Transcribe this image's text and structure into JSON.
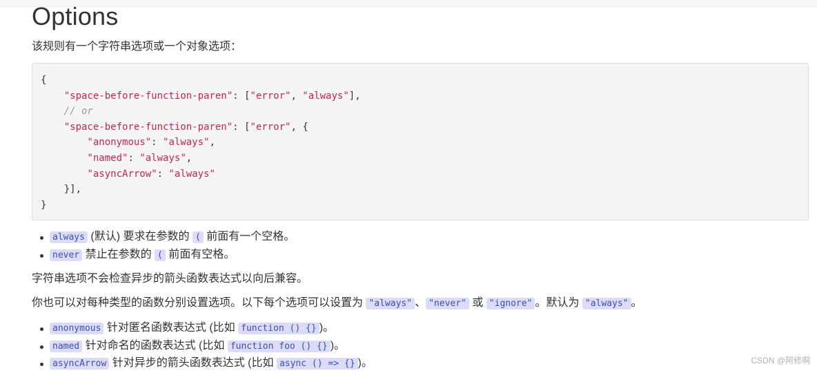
{
  "heading": "Options",
  "intro": "该规则有一个字符串选项或一个对象选项：",
  "code": {
    "open_brace": "{",
    "line1_key": "\"space-before-function-paren\"",
    "line1_rest": ": [",
    "line1_v1": "\"error\"",
    "line1_sep": ", ",
    "line1_v2": "\"always\"",
    "line1_end": "],",
    "comment": "// or",
    "line3_key": "\"space-before-function-paren\"",
    "line3_rest": ": [",
    "line3_v1": "\"error\"",
    "line3_end": ", {",
    "opt1_key": "\"anonymous\"",
    "opt1_val": "\"always\"",
    "opt2_key": "\"named\"",
    "opt2_val": "\"always\"",
    "opt3_key": "\"asyncArrow\"",
    "opt3_val": "\"always\"",
    "close_inner": "}],",
    "close_brace": "}"
  },
  "string_options": [
    {
      "code": "always",
      "pre": " (默认) 要求在参数的 ",
      "code2": "(",
      "post": " 前面有一个空格。"
    },
    {
      "code": "never",
      "pre": " 禁止在参数的 ",
      "code2": "(",
      "post": " 前面有空格。"
    }
  ],
  "note": "字符串选项不会检查异步的箭头函数表达式以向后兼容。",
  "object_para": {
    "text1": "你也可以对每种类型的函数分别设置选项。以下每个选项可以设置为 ",
    "v1": "\"always\"",
    "sep1": "、",
    "v2": "\"never\"",
    "sep2": " 或 ",
    "v3": "\"ignore\"",
    "text2": "。默认为 ",
    "v4": "\"always\"",
    "text3": "。"
  },
  "object_options": [
    {
      "code": "anonymous",
      "text": " 针对匿名函数表达式 (比如 ",
      "example": "function () {}",
      "end": ")。"
    },
    {
      "code": "named",
      "text": " 针对命名的函数表达式 (比如 ",
      "example": "function foo () {}",
      "end": ")。"
    },
    {
      "code": "asyncArrow",
      "text": " 针对异步的箭头函数表达式 (比如 ",
      "example": "async () => {}",
      "end": ")。"
    }
  ],
  "watermark": "CSDN @阿修啊"
}
